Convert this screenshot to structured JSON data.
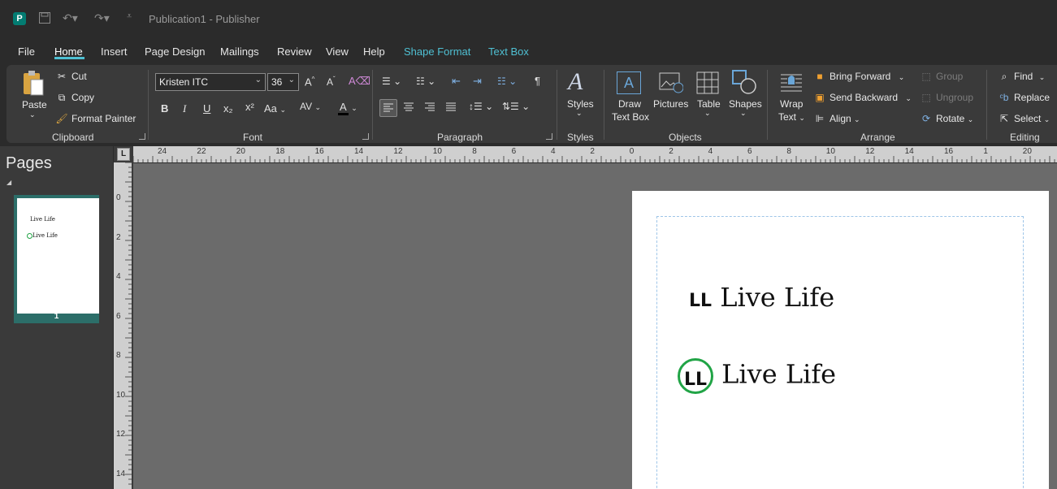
{
  "title_bar": {
    "title": "Publication1  -  Publisher",
    "app_icon": "P"
  },
  "tabs": [
    {
      "label": "File"
    },
    {
      "label": "Home"
    },
    {
      "label": "Insert"
    },
    {
      "label": "Page Design"
    },
    {
      "label": "Mailings"
    },
    {
      "label": "Review"
    },
    {
      "label": "View"
    },
    {
      "label": "Help"
    },
    {
      "label": "Shape Format"
    },
    {
      "label": "Text Box"
    }
  ],
  "ribbon": {
    "clipboard": {
      "label": "Clipboard",
      "paste": "Paste",
      "cut": "Cut",
      "copy": "Copy",
      "format_painter": "Format Painter"
    },
    "font": {
      "label": "Font",
      "font_name": "Kristen ITC",
      "font_size": "36",
      "bold": "B",
      "italic": "I",
      "underline": "U",
      "subscript": "x₂",
      "superscript": "x²",
      "change_case": "Aa",
      "spacing": "AV",
      "font_color": "A"
    },
    "paragraph": {
      "label": "Paragraph",
      "pilcrow": "¶"
    },
    "styles": {
      "label": "Styles",
      "button": "Styles"
    },
    "objects": {
      "label": "Objects",
      "draw_text_box_line1": "Draw",
      "draw_text_box_line2": "Text Box",
      "pictures": "Pictures",
      "table": "Table",
      "shapes": "Shapes"
    },
    "arrange": {
      "label": "Arrange",
      "wrap_text_line1": "Wrap",
      "wrap_text_line2": "Text",
      "bring_forward": "Bring Forward",
      "send_backward": "Send Backward",
      "align": "Align",
      "group": "Group",
      "ungroup": "Ungroup",
      "rotate": "Rotate"
    },
    "editing": {
      "label": "Editing",
      "find": "Find",
      "replace": "Replace",
      "select": "Select"
    }
  },
  "pages_pane": {
    "title": "Pages",
    "page_number": "1",
    "thumb_line1": "Live Life",
    "thumb_line2": "Live Life"
  },
  "ruler": {
    "horizontal": [
      "24",
      "22",
      "20",
      "18",
      "16",
      "14",
      "12",
      "10",
      "8",
      "6",
      "4",
      "2",
      "0",
      "2",
      "4",
      "6",
      "8",
      "10",
      "12",
      "14",
      "16",
      "1",
      "20"
    ],
    "vertical": [
      "0",
      "2",
      "4",
      "6",
      "8",
      "10",
      "12",
      "14"
    ],
    "corner": "L"
  },
  "document": {
    "logo1_mark": "LL",
    "logo1_text": "Live Life",
    "logo2_mark": "LL",
    "logo2_text": "Live Life",
    "circle_color": "#21a446"
  },
  "colors": {
    "accent": "#4fc0d3",
    "app_brand": "#037c72"
  }
}
